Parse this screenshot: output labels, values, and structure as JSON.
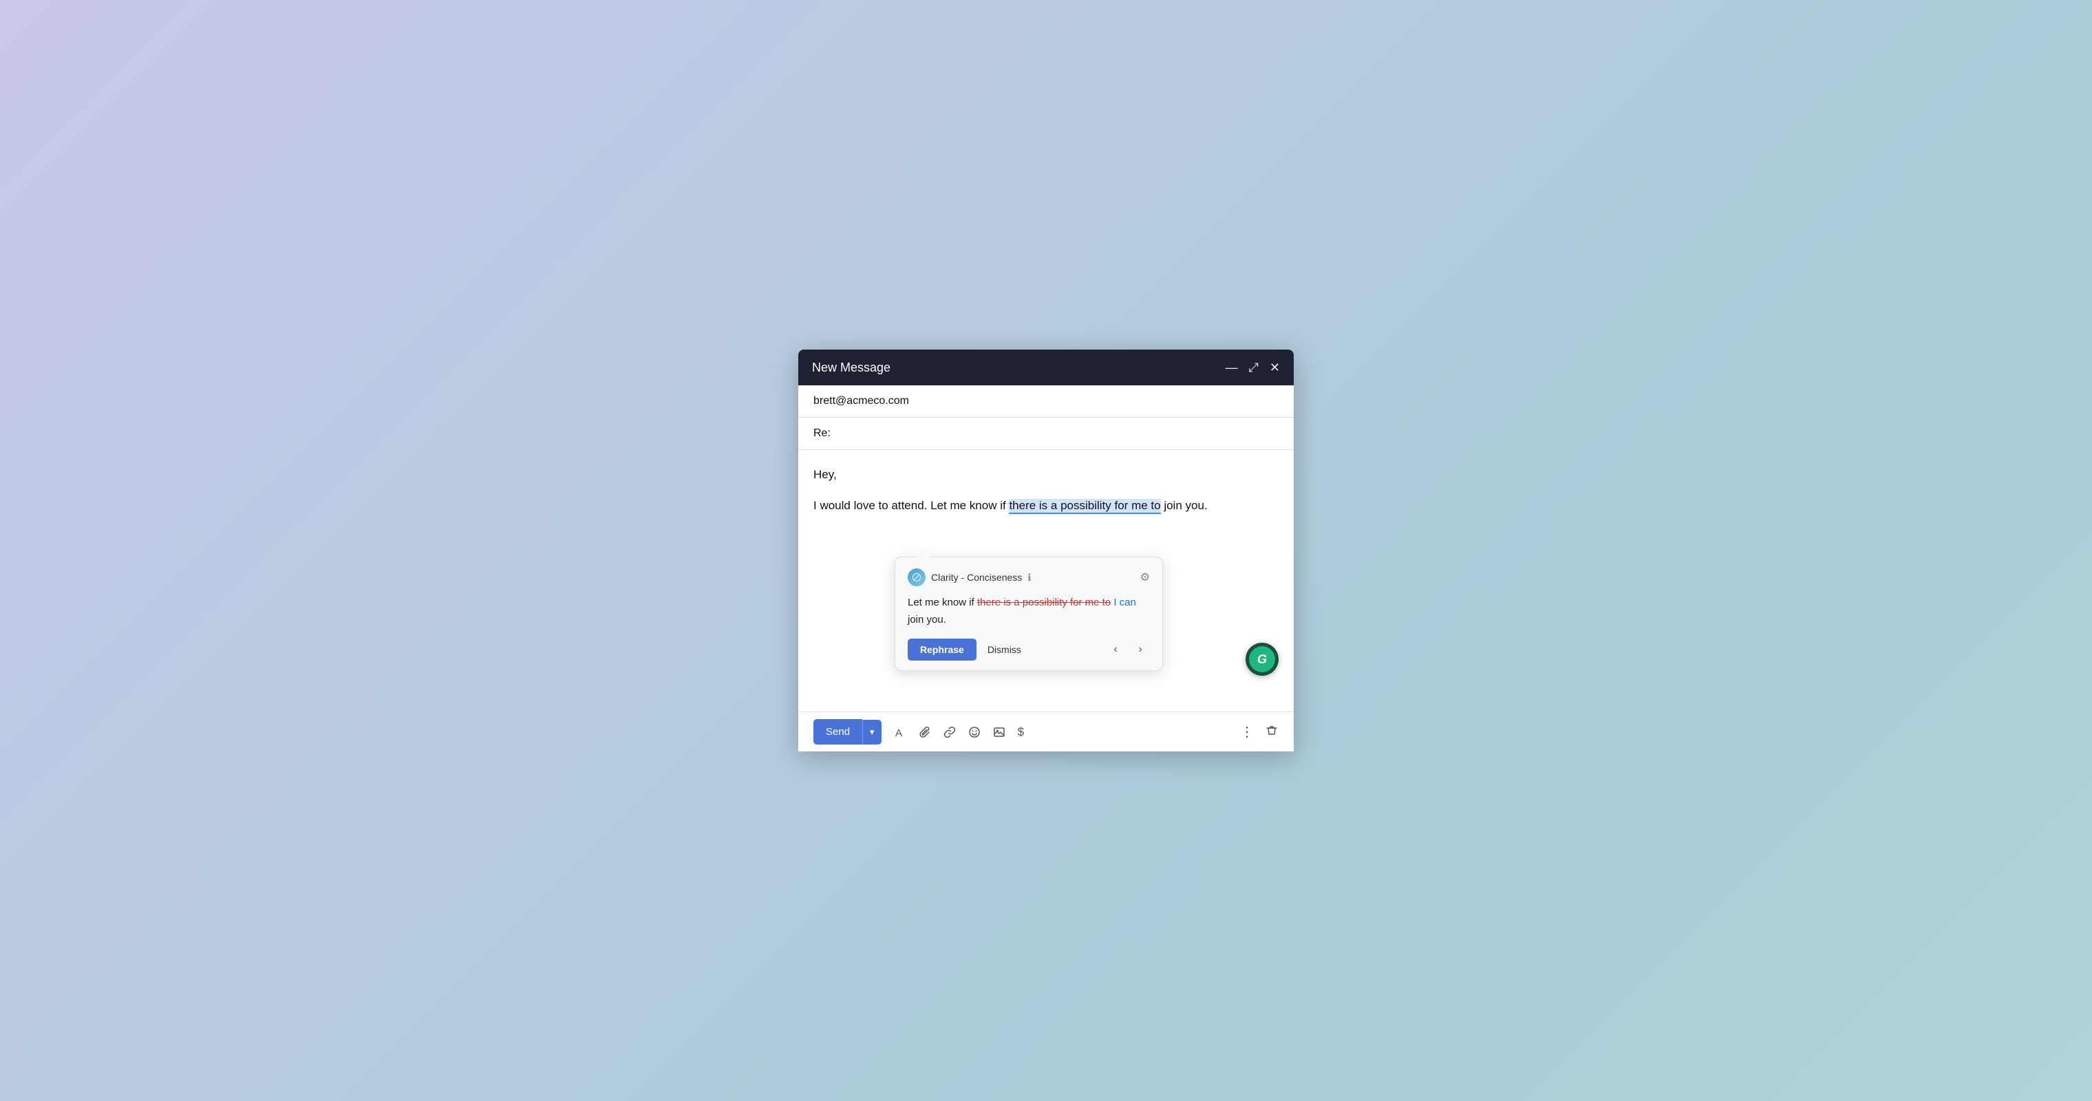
{
  "window": {
    "title": "New Message",
    "minimize_label": "—",
    "maximize_label": "⤢",
    "close_label": "✕"
  },
  "compose": {
    "to_value": "brett@acmeco.com",
    "subject_value": "Re:",
    "body_greeting": "Hey,",
    "body_line1_before": "I would love to attend. Let me know if ",
    "body_highlighted": "there is a possibility for me to",
    "body_line1_after": " join you."
  },
  "grammarly_popup": {
    "category": "Clarity - Conciseness",
    "suggestion_prefix": "Let me know if ",
    "strikethrough": "there is a possibility for me to",
    "insert": "I can",
    "suggestion_suffix": " join you.",
    "rephrase_label": "Rephrase",
    "dismiss_label": "Dismiss",
    "prev_label": "‹",
    "next_label": "›"
  },
  "grammarly_fab": {
    "letter": "G"
  },
  "toolbar": {
    "send_label": "Send",
    "send_arrow": "▾",
    "font_icon": "A",
    "attach_icon": "📎",
    "link_icon": "🔗",
    "emoji_icon": "☺",
    "image_icon": "🖼",
    "dollar_icon": "$",
    "more_icon": "⋮",
    "delete_icon": "🗑"
  }
}
